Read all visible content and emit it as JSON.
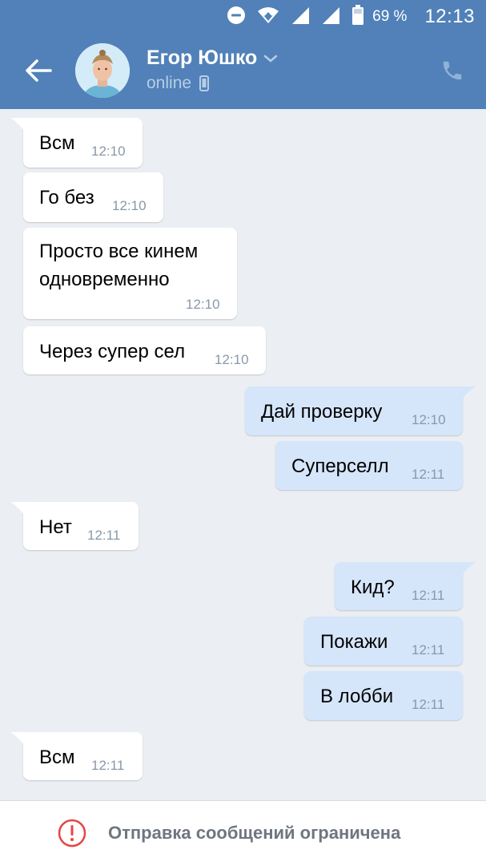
{
  "status_bar": {
    "icons": [
      "do-not-disturb-icon",
      "wifi-icon",
      "signal-icon",
      "signal-icon",
      "battery-icon"
    ],
    "battery": "69 %",
    "time": "12:13"
  },
  "toolbar": {
    "contact_name": "Егор Юшко",
    "status": "online",
    "icons": [
      "arrow-left-icon",
      "chevron-down-icon",
      "mobile-phone-icon",
      "phone-icon"
    ]
  },
  "messages": [
    {
      "side": "in",
      "text": "Всм",
      "time": "12:10"
    },
    {
      "side": "in",
      "text": "Го без",
      "time": "12:10"
    },
    {
      "side": "in",
      "text": "Просто все кинем\nодновременно",
      "text_line1": "Просто все кинем",
      "text_line2": "одновременно",
      "time": "12:10"
    },
    {
      "side": "in",
      "text": "Через супер сел",
      "time": "12:10"
    },
    {
      "side": "out",
      "text": "Дай проверку",
      "time": "12:10"
    },
    {
      "side": "out",
      "text": "Суперселл",
      "time": "12:11"
    },
    {
      "side": "in",
      "text": "Нет",
      "time": "12:11"
    },
    {
      "side": "out",
      "text": "Кид?",
      "time": "12:11"
    },
    {
      "side": "out",
      "text": "Покажи",
      "time": "12:11"
    },
    {
      "side": "out",
      "text": "В лобби",
      "time": "12:11"
    },
    {
      "side": "in",
      "text": "Всм",
      "time": "12:11"
    }
  ],
  "bottom_bar": {
    "icon": "exclamation-circle-icon",
    "text": "Отправка сообщений ограничена"
  },
  "colors": {
    "header": "#5181b8",
    "background": "#ebeef2",
    "incoming_bubble": "#ffffff",
    "outgoing_bubble": "#d5e5fa",
    "warning": "#e64646"
  }
}
